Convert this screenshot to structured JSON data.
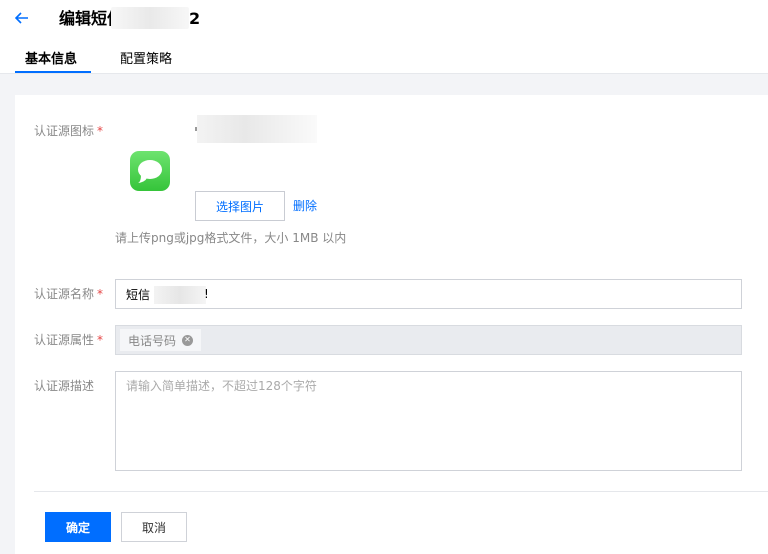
{
  "header": {
    "back_icon": "arrow-left-icon",
    "title_visible": "编辑短信",
    "title_tail": "2"
  },
  "tabs": [
    {
      "label": "基本信息",
      "active": true
    },
    {
      "label": "配置策略",
      "active": false
    }
  ],
  "form": {
    "icon_field": {
      "label": "认证源图标",
      "required_mark": "*",
      "image_icon": "message-bubble-icon",
      "select_button": "选择图片",
      "delete_link": "删除",
      "hint": "请上传png或jpg格式文件，大小 1MB 以内"
    },
    "name_field": {
      "label": "认证源名称",
      "required_mark": "*",
      "value_visible": "短信",
      "value_tail": "!"
    },
    "attr_field": {
      "label": "认证源属性",
      "required_mark": "*",
      "tag": "电话号码",
      "tag_remove_icon": "close-circle-icon"
    },
    "desc_field": {
      "label": "认证源描述",
      "placeholder": "请输入简单描述，不超过128个字符"
    }
  },
  "actions": {
    "confirm": "确定",
    "cancel": "取消"
  },
  "colors": {
    "accent": "#006eff",
    "required": "#e54545",
    "icon_green": "#35c43a"
  }
}
